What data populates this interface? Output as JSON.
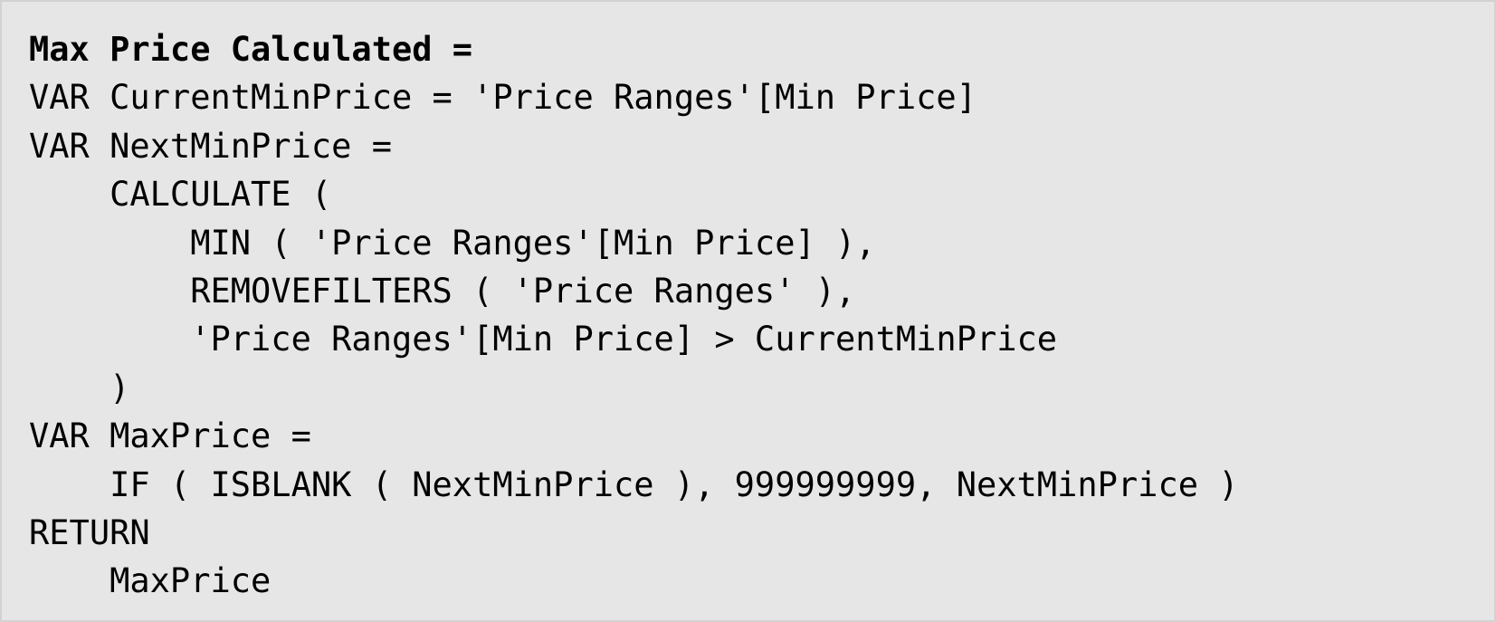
{
  "code": {
    "lines": [
      "Max Price Calculated =",
      "VAR CurrentMinPrice = 'Price Ranges'[Min Price]",
      "VAR NextMinPrice =",
      "    CALCULATE (",
      "        MIN ( 'Price Ranges'[Min Price] ),",
      "        REMOVEFILTERS ( 'Price Ranges' ),",
      "        'Price Ranges'[Min Price] > CurrentMinPrice",
      "    )",
      "VAR MaxPrice =",
      "    IF ( ISBLANK ( NextMinPrice ), 999999999, NextMinPrice )",
      "RETURN",
      "    MaxPrice"
    ]
  }
}
